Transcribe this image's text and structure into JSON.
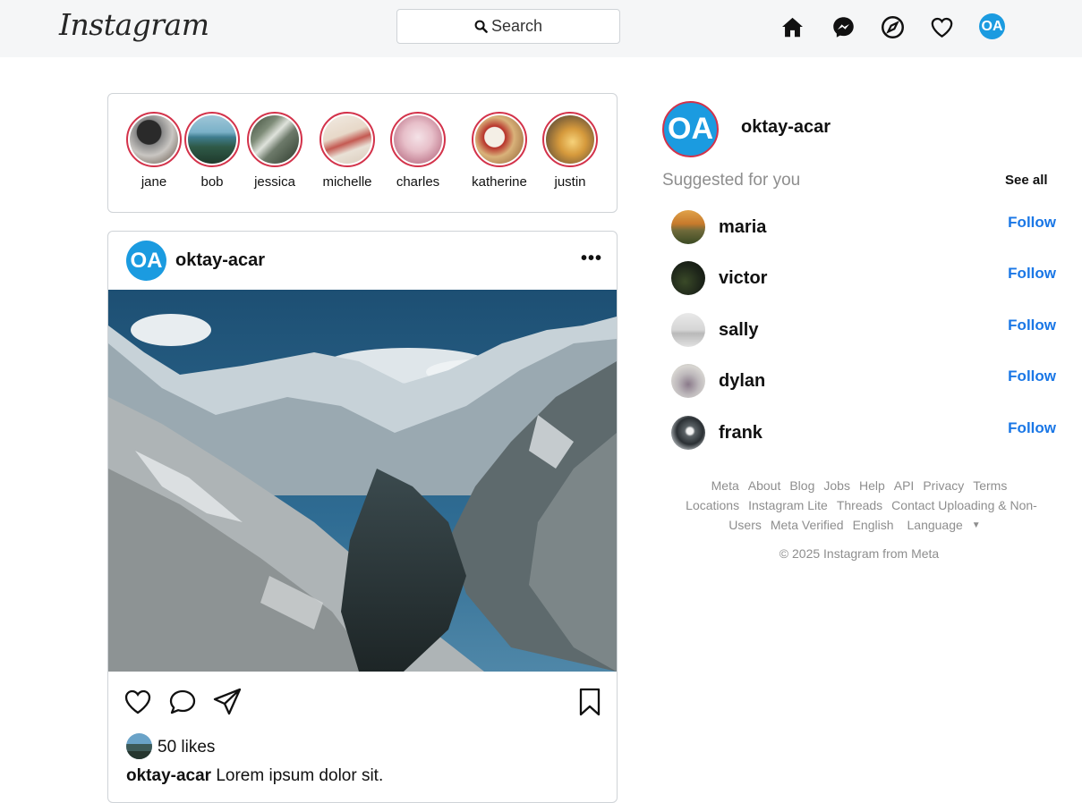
{
  "header": {
    "logo": "Instagram",
    "search_label": "Search"
  },
  "stories": [
    {
      "name": "jane"
    },
    {
      "name": "bob"
    },
    {
      "name": "jessica"
    },
    {
      "name": "michelle"
    },
    {
      "name": "charles"
    },
    {
      "name": "katherine"
    },
    {
      "name": "justin"
    }
  ],
  "post": {
    "avatar_initials": "OA",
    "username": "oktay-acar",
    "more": "•••",
    "likes": "50 likes",
    "caption_user": "oktay-acar",
    "caption_text": " Lorem ipsum dolor sit."
  },
  "sidebar": {
    "avatar_initials": "OA",
    "username": "oktay-acar",
    "suggested_title": "Suggested for you",
    "see_all": "See all",
    "follow_label": "Follow",
    "suggestions": [
      {
        "name": "maria"
      },
      {
        "name": "victor"
      },
      {
        "name": "sally"
      },
      {
        "name": "dylan"
      },
      {
        "name": "frank"
      }
    ]
  },
  "footer": {
    "links": [
      "Meta",
      "About",
      "Blog",
      "Jobs",
      "Help",
      "API",
      "Privacy",
      "Terms",
      "Locations",
      "Instagram Lite",
      "Threads",
      "Contact Uploading & Non-Users",
      "Meta Verified",
      "English"
    ],
    "language_label": "Language",
    "copyright": "© 2025 Instagram from Meta"
  },
  "colors": {
    "accent_blue": "#1a77e6",
    "avatar_blue": "#1b9be0",
    "story_ring": "#d3324a",
    "header_bg": "#f5f6f7"
  },
  "icons": [
    "search-icon",
    "home-icon",
    "messenger-icon",
    "compass-icon",
    "heart-icon",
    "comment-icon",
    "share-icon",
    "bookmark-icon"
  ]
}
